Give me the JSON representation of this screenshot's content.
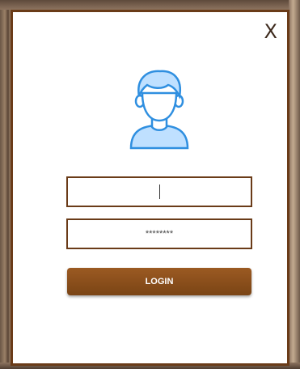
{
  "dialog": {
    "close_label": "X",
    "avatar_icon": "user-avatar-icon",
    "username": {
      "value": ""
    },
    "password": {
      "masked_value": "********"
    },
    "login_label": "LOGIN"
  },
  "colors": {
    "border": "#6a3b18",
    "button": "#8a4c1b",
    "avatar_fill": "#bfe0ff",
    "avatar_stroke": "#2f8fe0"
  }
}
